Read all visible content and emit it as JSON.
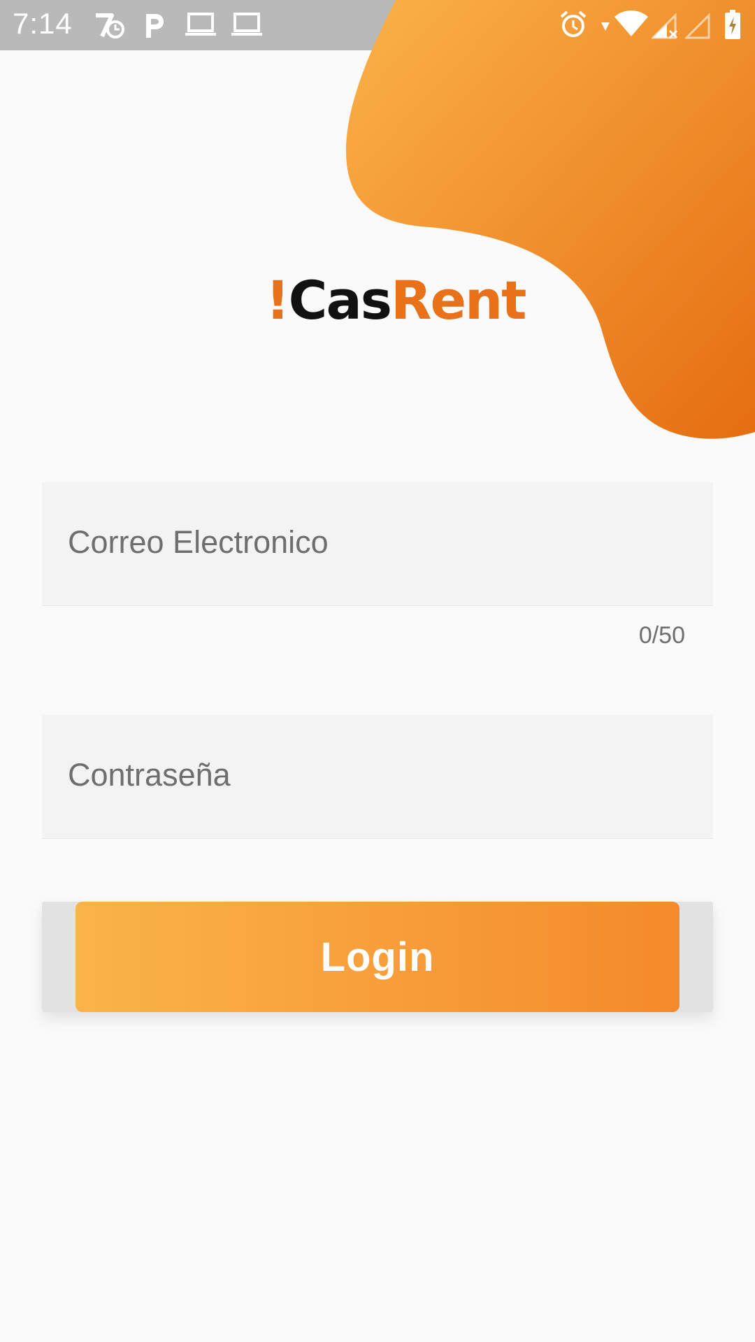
{
  "status_bar": {
    "time": "7:14",
    "left_icons": [
      "tasker-icon",
      "parking-icon",
      "laptop-icon",
      "laptop-icon"
    ],
    "right_icons": [
      "alarm-icon",
      "wifi-icon",
      "signal-icon",
      "signal-empty-icon",
      "battery-charging-icon"
    ]
  },
  "brand": {
    "bang": "!",
    "cas": "Cas",
    "rent": "Rent"
  },
  "form": {
    "email_label": "Correo Electronico",
    "email_counter": "0/50",
    "password_label": "Contraseña",
    "login_label": "Login"
  },
  "colors": {
    "accent_light": "#fbb34b",
    "accent_dark": "#e8711a",
    "background": "#fafafa"
  }
}
